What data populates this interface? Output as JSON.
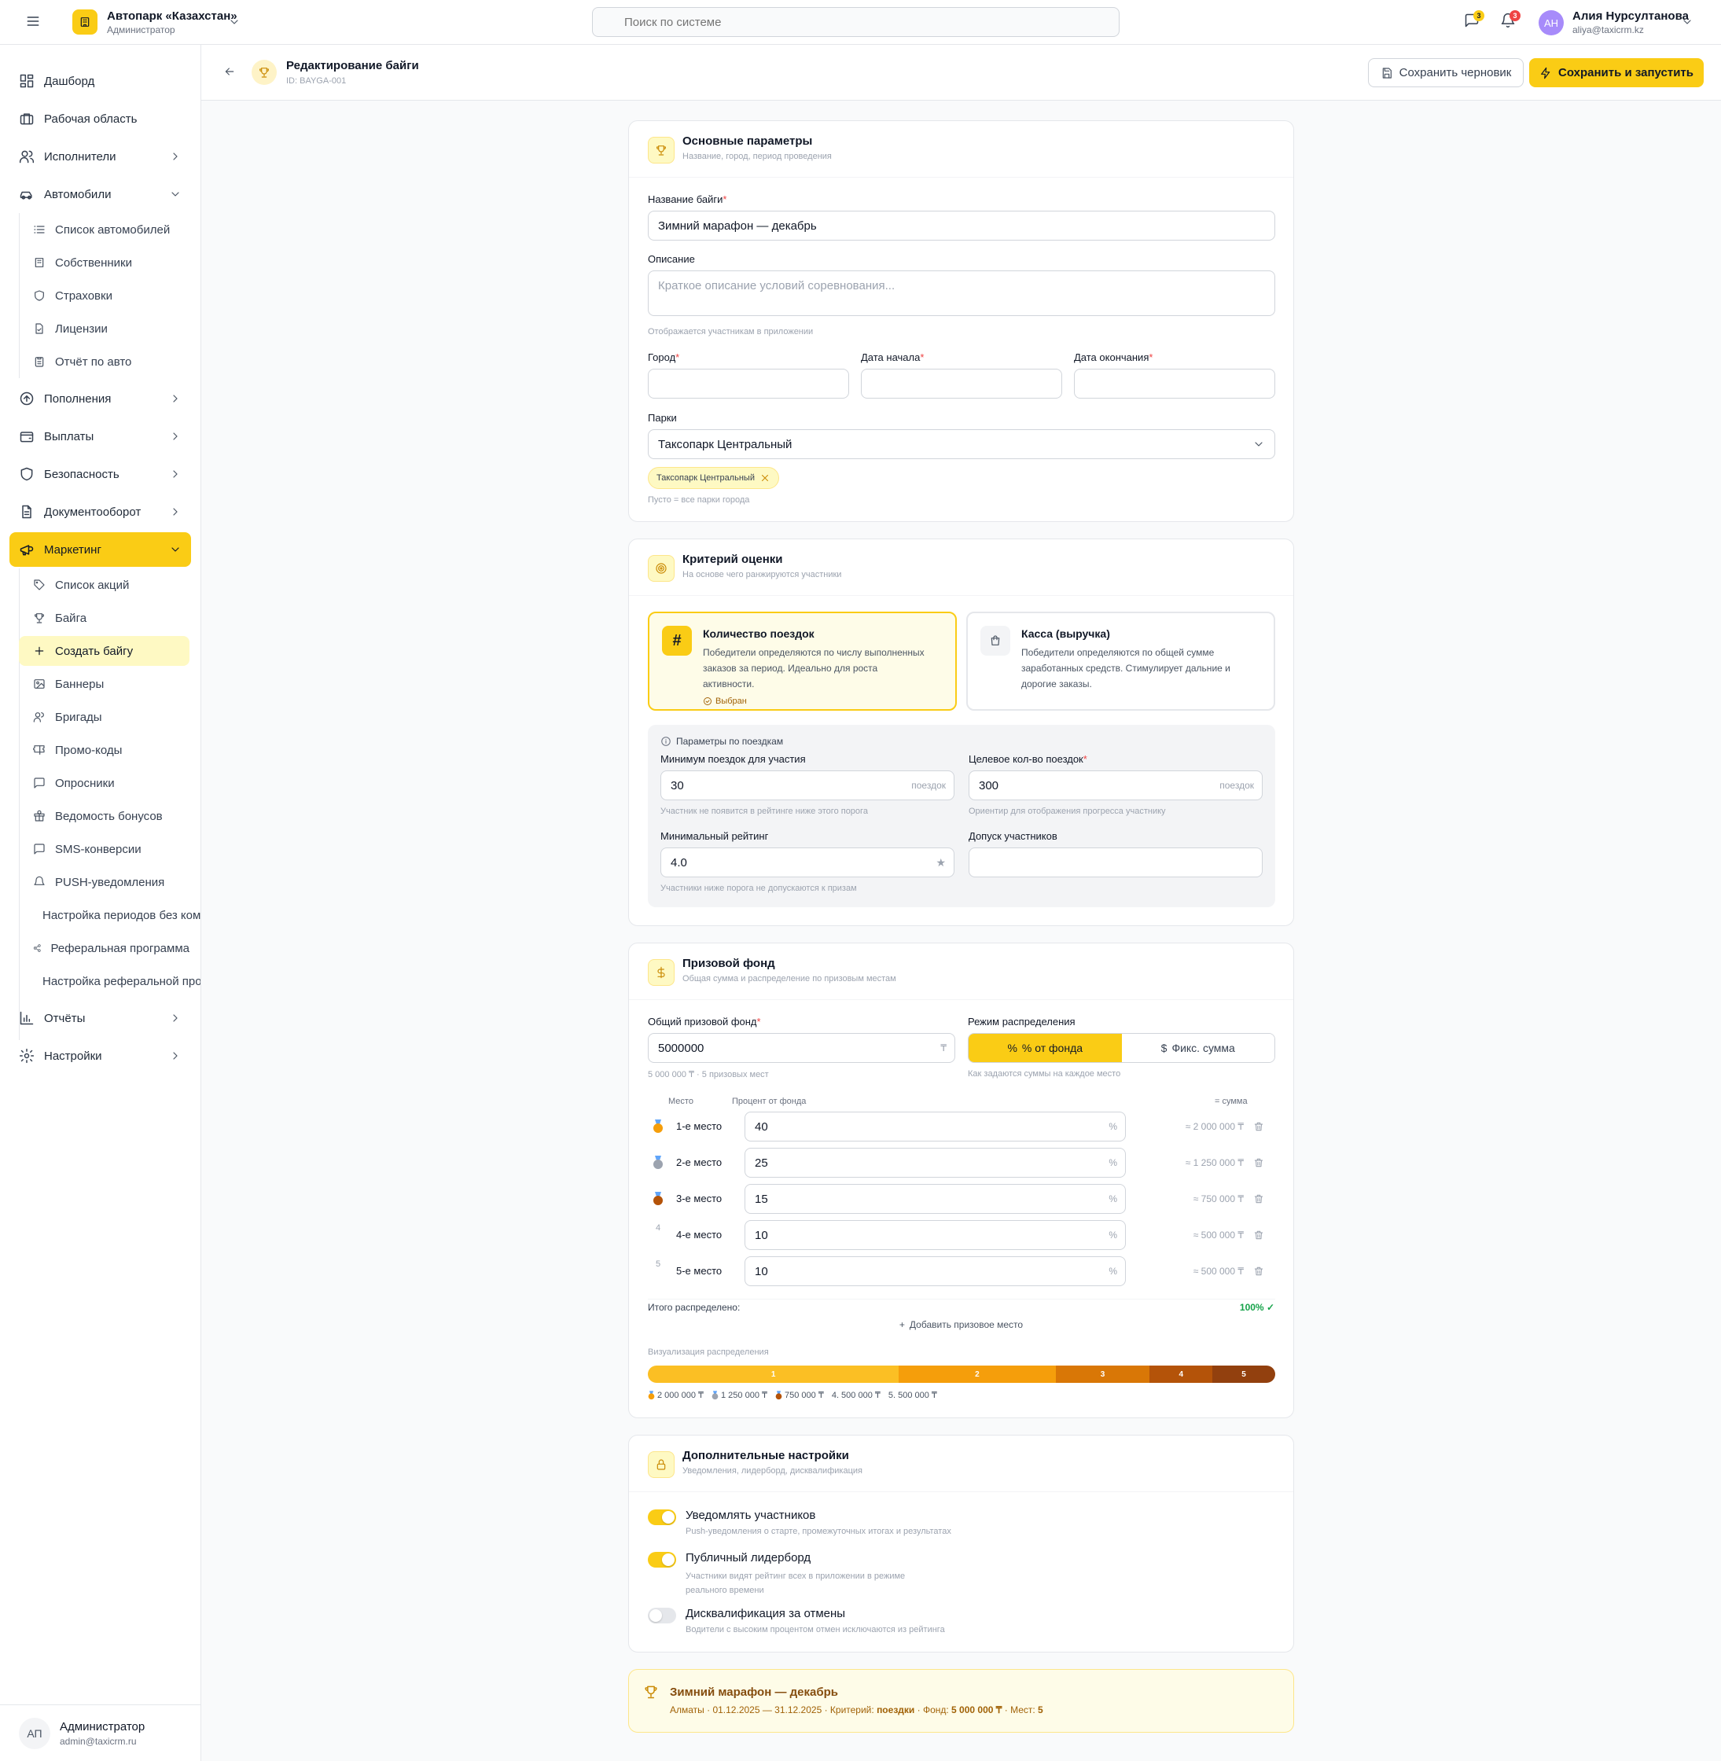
{
  "topbar": {
    "org_name": "Автопарк «Казахстан»",
    "org_role": "Администратор",
    "search_placeholder": "Поиск по системе",
    "messages_badge": "3",
    "notifications_badge": "3",
    "user_initials": "АН",
    "user_name": "Алия Нурсултанова",
    "user_email": "aliya@taxicrm.kz"
  },
  "sidebar": {
    "dashboard": "Дашборд",
    "workspace": "Рабочая область",
    "executors": "Исполнители",
    "cars": "Автомобили",
    "cars_items": [
      "Список автомобилей",
      "Собственники",
      "Страховки",
      "Лицензии",
      "Отчёт по авто"
    ],
    "topups": "Пополнения",
    "payouts": "Выплаты",
    "security": "Безопасность",
    "docflow": "Документооборот",
    "marketing": "Маркетинг",
    "marketing_items": [
      "Список акций",
      "Байга",
      "Создать байгу",
      "Баннеры",
      "Бригады",
      "Промо-коды",
      "Опросники",
      "Ведомость бонусов",
      "SMS-конверсии",
      "PUSH-уведомления",
      "Настройка периодов без комиссии",
      "Реферальная программа",
      "Настройка реферальной программы"
    ],
    "reports": "Отчёты",
    "settings": "Настройки",
    "footer_initials": "АП",
    "footer_name": "Администратор",
    "footer_email": "admin@taxicrm.ru"
  },
  "page_header": {
    "title": "Редактирование байги",
    "id": "ID: BAYGA-001",
    "save_draft": "Сохранить черновик",
    "save_launch": "Сохранить и запустить"
  },
  "basic": {
    "title": "Основные параметры",
    "subtitle": "Название, город, период проведения",
    "name_label": "Название байги",
    "name_value": "Зимний марафон — декабрь",
    "desc_label": "Описание",
    "desc_placeholder": "Краткое описание условий соревнования...",
    "desc_hint": "Отображается участникам в приложении",
    "city_label": "Город",
    "start_label": "Дата начала",
    "end_label": "Дата окончания",
    "parks_label": "Парки",
    "parks_value": "Таксопарк Центральный",
    "park_chip": "Таксопарк Центральный",
    "parks_hint": "Пусто = все парки города"
  },
  "criteria": {
    "title": "Критерий оценки",
    "subtitle": "На основе чего ранжируются участники",
    "opt1_title": "Количество поездок",
    "opt1_desc_1": "Победители определяются по числу выполненных",
    "opt1_desc_2": "заказов за период. Идеально для роста",
    "opt1_desc_3": "активности.",
    "opt1_selected": "Выбран",
    "opt2_title": "Касса (выручка)",
    "opt2_desc_1": "Победители определяются по общей сумме",
    "opt2_desc_2": "заработанных средств. Стимулирует дальние и",
    "opt2_desc_3": "дорогие заказы.",
    "params_title": "Параметры по поездкам",
    "min_trips_label": "Минимум поездок для участия",
    "min_trips_value": "30",
    "min_trips_suffix": "поездок",
    "min_trips_hint": "Участник не появится в рейтинге ниже этого порога",
    "target_label": "Целевое кол-во поездок",
    "target_value": "300",
    "target_suffix": "поездок",
    "target_hint": "Ориентир для отображения прогресса участнику",
    "min_rating_label": "Минимальный рейтинг",
    "min_rating_value": "4.0",
    "min_rating_hint": "Участники ниже порога не допускаются к призам",
    "admission_label": "Допуск участников"
  },
  "prize": {
    "title": "Призовой фонд",
    "subtitle": "Общая сумма и распределение по призовым местам",
    "total_label": "Общий призовой фонд",
    "total_value": "5000000",
    "currency": "₸",
    "total_hint": "5 000 000 ₸ · 5 призовых мест",
    "mode_label": "Режим распределения",
    "mode_percent": "% от фонда",
    "mode_fixed": "Фикс. сумма",
    "mode_hint": "Как задаются суммы на каждое место",
    "col_place": "Место",
    "col_percent": "Процент от фонда",
    "col_sum": "= сумма",
    "rows": [
      {
        "num": "1",
        "label": "1-е место",
        "value": "40",
        "unit": "%",
        "sum": "≈ 2 000 000 ₸",
        "color": "#f59e0b"
      },
      {
        "num": "2",
        "label": "2-е место",
        "value": "25",
        "unit": "%",
        "sum": "≈ 1 250 000 ₸",
        "color": "#9ca3af"
      },
      {
        "num": "3",
        "label": "3-е место",
        "value": "15",
        "unit": "%",
        "sum": "≈ 750 000 ₸",
        "color": "#b45309"
      },
      {
        "num": "4",
        "label": "4-е место",
        "value": "10",
        "unit": "%",
        "sum": "≈ 500 000 ₸",
        "color": ""
      },
      {
        "num": "5",
        "label": "5-е место",
        "value": "10",
        "unit": "%",
        "sum": "≈ 500 000 ₸",
        "color": ""
      }
    ],
    "total_dist_label": "Итого распределено:",
    "total_dist_value": "100%",
    "add_place": "Добавить призовое место",
    "viz_label": "Визуализация распределения",
    "bar_segments": [
      {
        "label": "1",
        "percent": 40,
        "color": "#fbbf24"
      },
      {
        "label": "2",
        "percent": 25,
        "color": "#f59e0b"
      },
      {
        "label": "3",
        "percent": 15,
        "color": "#d97706"
      },
      {
        "label": "4",
        "percent": 10,
        "color": "#b45309"
      },
      {
        "label": "5",
        "percent": 10,
        "color": "#92400e"
      }
    ],
    "legend": [
      "2 000 000 ₸",
      "1 250 000 ₸",
      "750 000 ₸",
      "4. 500 000 ₸",
      "5. 500 000 ₸"
    ]
  },
  "extra": {
    "title": "Дополнительные настройки",
    "subtitle": "Уведомления, лидерборд, дисквалификация",
    "t1_title": "Уведомлять участников",
    "t1_desc": "Push-уведомления о старте, промежуточных итогах и результатах",
    "t1_on": true,
    "t2_title": "Публичный лидерборд",
    "t2_desc_1": "Участники видят рейтинг всех в приложении в режиме",
    "t2_desc_2": "реального времени",
    "t2_on": true,
    "t3_title": "Дисквалификация за отмены",
    "t3_desc": "Водители с высоким процентом отмен исключаются из рейтинга",
    "t3_on": false
  },
  "summary": {
    "title": "Зимний марафон — декабрь",
    "text_prefix": "Алматы · 01.12.2025 — 31.12.2025 · Критерий: ",
    "criterion": "поездки",
    "fund_prefix": " · Фонд: ",
    "fund": "5 000 000 ₸",
    "places_prefix": " · Мест: ",
    "places": "5"
  },
  "colors": {
    "accent": "#facc15",
    "accent_light": "#fef9c3",
    "success": "#16a34a",
    "danger": "#ef4444"
  }
}
